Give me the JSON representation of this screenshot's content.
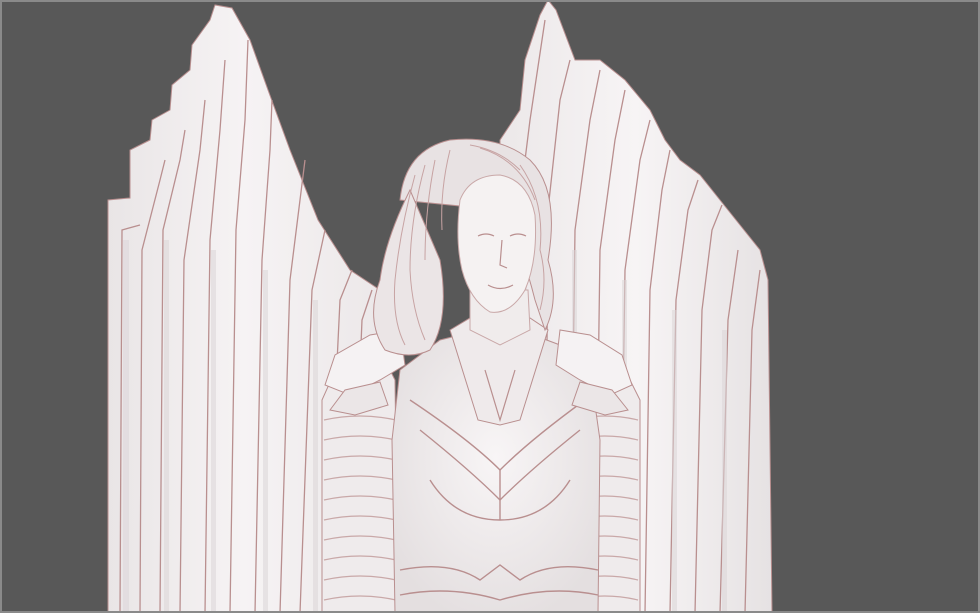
{
  "viewport": {
    "background_color": "#585858",
    "frame_color": "#8a8a8a"
  },
  "model": {
    "surface_color": "#f1eeef",
    "edge_color": "#b98f8f",
    "shadow_color": "#c9c2c4"
  }
}
